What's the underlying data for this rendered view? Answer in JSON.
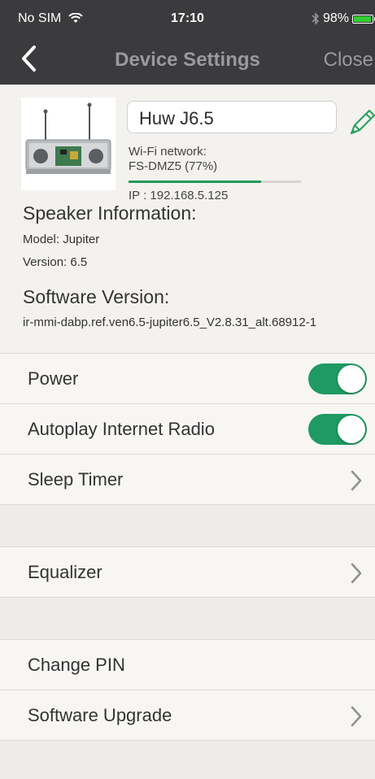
{
  "status_bar": {
    "carrier": "No SIM",
    "time": "17:10",
    "battery": "98%",
    "battery_level": 0.98,
    "bluetooth_icon": "bluetooth-icon",
    "wifi_icon": "wifi-icon"
  },
  "nav": {
    "title": "Device Settings",
    "close_label": "Close",
    "back_icon": "chevron-left-icon"
  },
  "device": {
    "name": "Huw J6.5",
    "edit_icon": "pencil-icon",
    "wifi_label": "Wi-Fi network:",
    "wifi_network": "FS-DMZ5 (77%)",
    "wifi_strength": 0.77,
    "ip": "IP : 192.168.5.125"
  },
  "speaker_info": {
    "title": "Speaker Information:",
    "model": "Model: Jupiter",
    "version": "Version: 6.5"
  },
  "software": {
    "title": "Software Version:",
    "version": "ir-mmi-dabp.ref.ven6.5-jupiter6.5_V2.8.31_alt.68912-1"
  },
  "settings": {
    "power": {
      "label": "Power",
      "on": true
    },
    "autoplay": {
      "label": "Autoplay Internet Radio",
      "on": true
    },
    "sleep_timer": {
      "label": "Sleep Timer"
    },
    "equalizer": {
      "label": "Equalizer"
    },
    "change_pin": {
      "label": "Change PIN"
    },
    "software_upgrade": {
      "label": "Software Upgrade"
    }
  },
  "colors": {
    "accent": "#1f9a62",
    "topbar": "#3b3b3d"
  }
}
